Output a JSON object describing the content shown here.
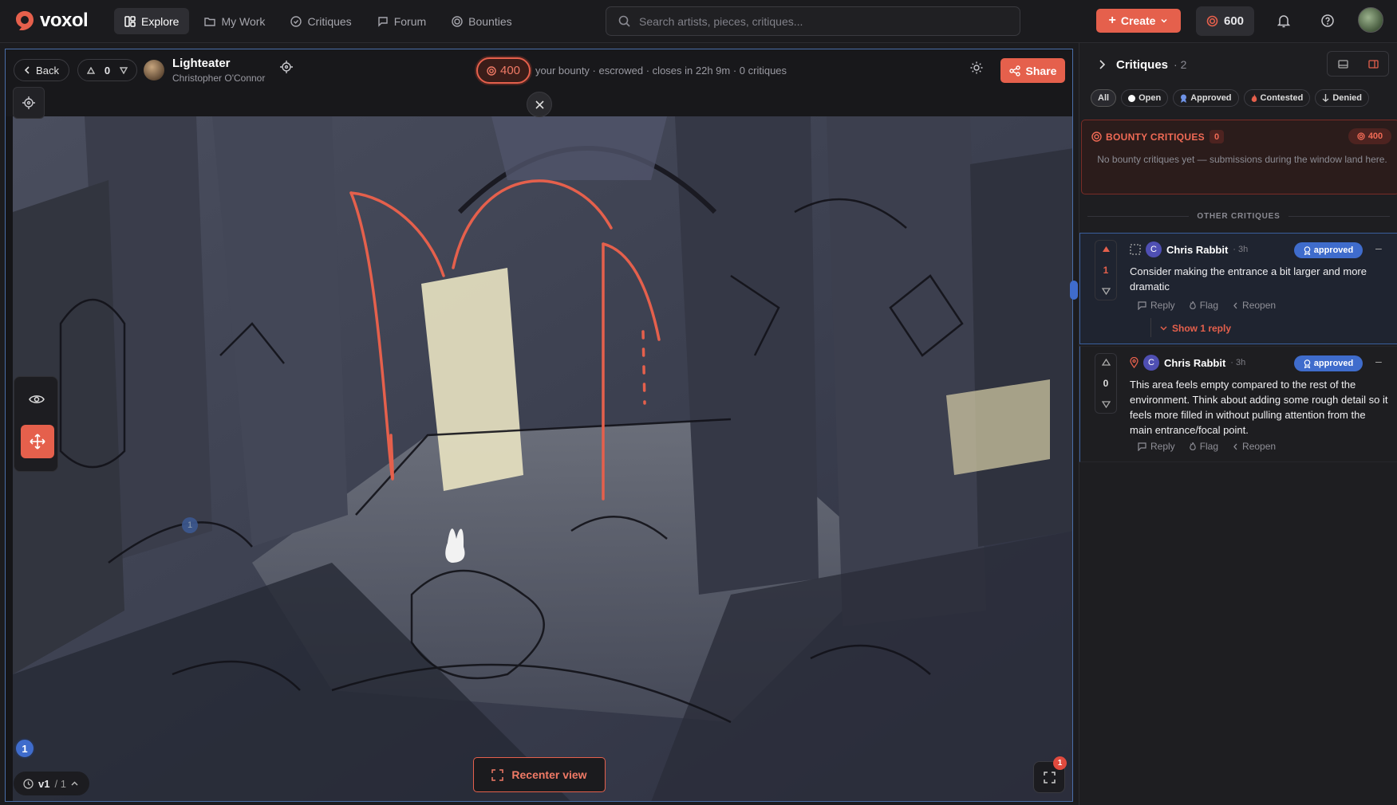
{
  "app": {
    "name": "voxol"
  },
  "nav": {
    "items": [
      {
        "label": "Explore",
        "icon": "grid-icon",
        "active": true
      },
      {
        "label": "My Work",
        "icon": "folder-icon",
        "active": false
      },
      {
        "label": "Critiques",
        "icon": "check-circle-icon",
        "active": false
      },
      {
        "label": "Forum",
        "icon": "chat-icon",
        "active": false
      },
      {
        "label": "Bounties",
        "icon": "coin-icon",
        "active": false
      }
    ]
  },
  "search": {
    "placeholder": "Search artists, pieces, critiques..."
  },
  "header": {
    "create_label": "Create",
    "credits": "600"
  },
  "viewer": {
    "back_label": "Back",
    "votes": "0",
    "piece_title": "Lighteater",
    "piece_author": "Christopher O'Connor",
    "bounty_amount": "400",
    "bounty_info": "your bounty · escrowed · closes in 22h 9m · 0 critiques",
    "share_label": "Share",
    "pin_faded": "1",
    "pin_active": "1",
    "version_label": "v1",
    "version_total": "/ 1",
    "recenter_label": "Recenter view",
    "expand_badge": "1"
  },
  "panel": {
    "title": "Critiques",
    "count": "2",
    "filters": [
      {
        "label": "All",
        "icon": ""
      },
      {
        "label": "Open",
        "icon": "dot-icon"
      },
      {
        "label": "Approved",
        "icon": "ribbon-icon"
      },
      {
        "label": "Contested",
        "icon": "flame-icon"
      },
      {
        "label": "Denied",
        "icon": "arrow-down-icon"
      }
    ],
    "bounty": {
      "title": "BOUNTY CRITIQUES",
      "count": "0",
      "amount": "400",
      "empty_text": "No bounty critiques yet — submissions during the window land here."
    },
    "other_label": "OTHER CRITIQUES",
    "critiques": [
      {
        "avatar": "C",
        "author": "Chris Rabbit",
        "time": "3h",
        "status": "approved",
        "votes": "1",
        "body": "Consider making the entrance a bit larger and more dramatic",
        "actions": [
          "Reply",
          "Flag",
          "Reopen"
        ],
        "show_reply": "Show 1 reply"
      },
      {
        "avatar": "C",
        "author": "Chris Rabbit",
        "time": "3h",
        "status": "approved",
        "votes": "0",
        "body": "This area feels empty compared to the rest of the environment. Think about adding some rough detail so it feels more filled in without pulling attention from the main entrance/focal point.",
        "actions": [
          "Reply",
          "Flag",
          "Reopen"
        ]
      }
    ]
  },
  "colors": {
    "accent": "#e5604c",
    "approved": "#3f6ccc",
    "bg": "#1c1c1f"
  }
}
